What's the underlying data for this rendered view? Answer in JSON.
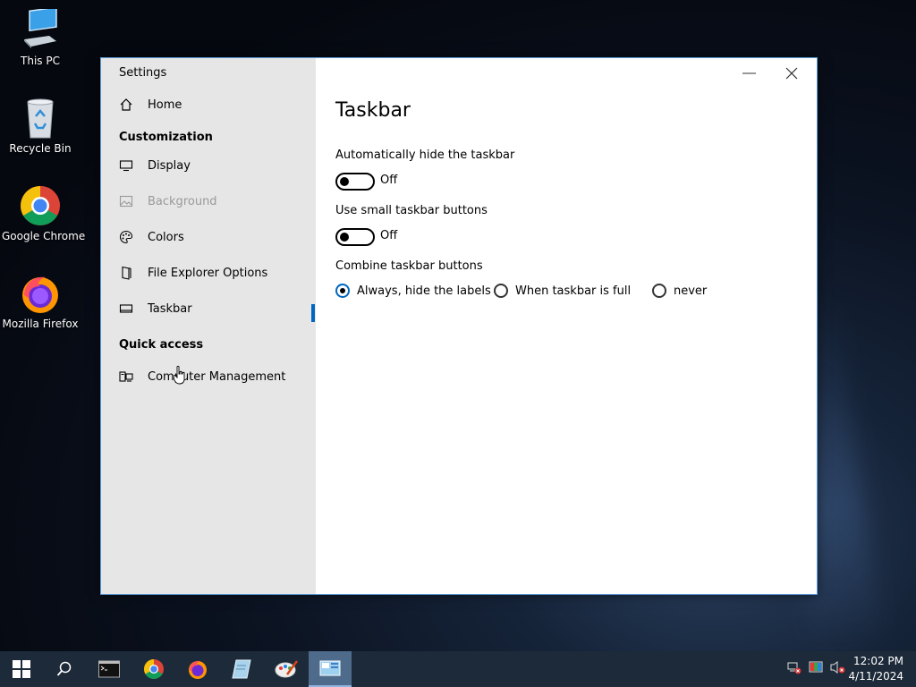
{
  "desktop": {
    "icons": [
      {
        "label": "This PC",
        "icon": "this-pc-icon"
      },
      {
        "label": "Recycle Bin",
        "icon": "recycle-bin-icon"
      },
      {
        "label": "Google Chrome",
        "icon": "chrome-icon"
      },
      {
        "label": "Mozilla Firefox",
        "icon": "firefox-icon"
      }
    ]
  },
  "window": {
    "title": "Settings",
    "minimize_glyph": "—",
    "close_glyph": "✕"
  },
  "sidebar": {
    "home": "Home",
    "section_customization": "Customization",
    "items": [
      {
        "label": "Display",
        "icon": "display-icon",
        "enabled": true
      },
      {
        "label": "Background",
        "icon": "picture-icon",
        "enabled": false
      },
      {
        "label": "Colors",
        "icon": "palette-icon",
        "enabled": true
      },
      {
        "label": "File Explorer Options",
        "icon": "file-explorer-icon",
        "enabled": true
      },
      {
        "label": "Taskbar",
        "icon": "taskbar-icon",
        "enabled": true,
        "selected": true
      }
    ],
    "section_quick_access": "Quick access",
    "quick_items": [
      {
        "label": "Computer Management",
        "icon": "computer-management-icon"
      }
    ]
  },
  "main": {
    "title": "Taskbar",
    "auto_hide": {
      "label": "Automatically hide the taskbar",
      "state": "Off"
    },
    "small_buttons": {
      "label": "Use small taskbar buttons",
      "state": "Off"
    },
    "combine": {
      "label": "Combine taskbar buttons",
      "options": [
        "Always, hide the labels",
        "When taskbar is full",
        "never"
      ],
      "selected": "Always, hide the labels"
    }
  },
  "taskbar": {
    "time": "12:02 PM",
    "date": "4/11/2024",
    "accent": "#0067c0"
  }
}
